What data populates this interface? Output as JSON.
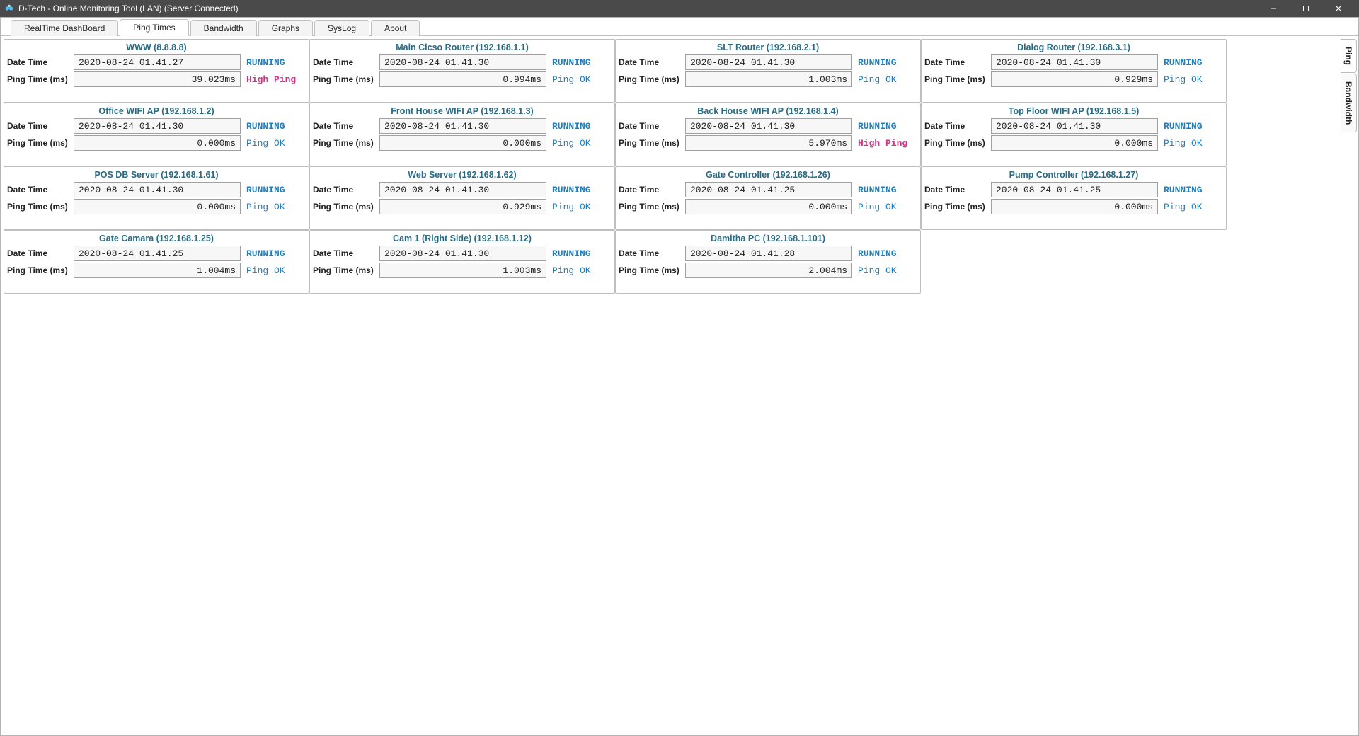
{
  "window": {
    "title": "D-Tech - Online Monitoring Tool (LAN) (Server Connected)"
  },
  "tabs": [
    {
      "label": "RealTime DashBoard",
      "active": false
    },
    {
      "label": "Ping Times",
      "active": true
    },
    {
      "label": "Bandwidth",
      "active": false
    },
    {
      "label": "Graphs",
      "active": false
    },
    {
      "label": "SysLog",
      "active": false
    },
    {
      "label": "About",
      "active": false
    }
  ],
  "side_tabs": [
    {
      "label": "Ping",
      "active": true
    },
    {
      "label": "Bandwidth",
      "active": false
    }
  ],
  "labels": {
    "datetime": "Date Time",
    "pingtime": "Ping Time (ms)"
  },
  "status_text": {
    "running": "RUNNING",
    "ok": "Ping OK",
    "high": "High Ping"
  },
  "cards": [
    {
      "title": "WWW (8.8.8.8)",
      "datetime": "2020-08-24 01.41.27",
      "ping": "39.023ms",
      "state": "RUNNING",
      "ping_status": "high"
    },
    {
      "title": "Main Cicso Router  (192.168.1.1)",
      "datetime": "2020-08-24 01.41.30",
      "ping": "0.994ms",
      "state": "RUNNING",
      "ping_status": "ok"
    },
    {
      "title": "SLT Router (192.168.2.1)",
      "datetime": "2020-08-24 01.41.30",
      "ping": "1.003ms",
      "state": "RUNNING",
      "ping_status": "ok"
    },
    {
      "title": "Dialog Router (192.168.3.1)",
      "datetime": "2020-08-24 01.41.30",
      "ping": "0.929ms",
      "state": "RUNNING",
      "ping_status": "ok"
    },
    {
      "title": "Office WIFI AP (192.168.1.2)",
      "datetime": "2020-08-24 01.41.30",
      "ping": "0.000ms",
      "state": "RUNNING",
      "ping_status": "ok"
    },
    {
      "title": "Front House WIFI AP (192.168.1.3)",
      "datetime": "2020-08-24 01.41.30",
      "ping": "0.000ms",
      "state": "RUNNING",
      "ping_status": "ok"
    },
    {
      "title": "Back House WIFI AP (192.168.1.4)",
      "datetime": "2020-08-24 01.41.30",
      "ping": "5.970ms",
      "state": "RUNNING",
      "ping_status": "high"
    },
    {
      "title": "Top Floor WIFI AP (192.168.1.5)",
      "datetime": "2020-08-24 01.41.30",
      "ping": "0.000ms",
      "state": "RUNNING",
      "ping_status": "ok"
    },
    {
      "title": "POS DB Server (192.168.1.61)",
      "datetime": "2020-08-24 01.41.30",
      "ping": "0.000ms",
      "state": "RUNNING",
      "ping_status": "ok"
    },
    {
      "title": "Web Server (192.168.1.62)",
      "datetime": "2020-08-24 01.41.30",
      "ping": "0.929ms",
      "state": "RUNNING",
      "ping_status": "ok"
    },
    {
      "title": "Gate Controller  (192.168.1.26)",
      "datetime": "2020-08-24 01.41.25",
      "ping": "0.000ms",
      "state": "RUNNING",
      "ping_status": "ok"
    },
    {
      "title": "Pump Controller  (192.168.1.27)",
      "datetime": "2020-08-24 01.41.25",
      "ping": "0.000ms",
      "state": "RUNNING",
      "ping_status": "ok"
    },
    {
      "title": "Gate Camara  (192.168.1.25)",
      "datetime": "2020-08-24 01.41.25",
      "ping": "1.004ms",
      "state": "RUNNING",
      "ping_status": "ok"
    },
    {
      "title": "Cam 1 (Right Side)  (192.168.1.12)",
      "datetime": "2020-08-24 01.41.30",
      "ping": "1.003ms",
      "state": "RUNNING",
      "ping_status": "ok"
    },
    {
      "title": "Damitha PC  (192.168.1.101)",
      "datetime": "2020-08-24 01.41.28",
      "ping": "2.004ms",
      "state": "RUNNING",
      "ping_status": "ok"
    }
  ]
}
